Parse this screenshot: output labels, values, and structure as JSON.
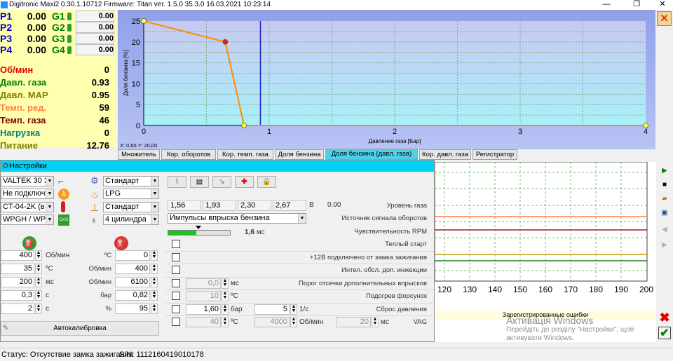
{
  "window": {
    "title": "Digitronic Maxi2 0.30.1.10712 Firmware: Titan  ver. 1.5.0  35.3.0  16.03.2021 10:23:14",
    "minimize": "—",
    "restore": "❐",
    "close": "✕"
  },
  "left": {
    "p": [
      {
        "label": "P1",
        "value": "0.00",
        "g_label": "G1",
        "g_value": "0.00"
      },
      {
        "label": "P2",
        "value": "0.00",
        "g_label": "G2",
        "g_value": "0.00"
      },
      {
        "label": "P3",
        "value": "0.00",
        "g_label": "G3",
        "g_value": "0.00"
      },
      {
        "label": "P4",
        "value": "0.00",
        "g_label": "G4",
        "g_value": "0.00"
      }
    ],
    "stats": [
      {
        "label": "Об/мин",
        "value": "0",
        "color": "#e00000"
      },
      {
        "label": "Давл. газа",
        "value": "0.93",
        "color": "#008000"
      },
      {
        "label": "Давл. MAP",
        "value": "0.95",
        "color": "#808000"
      },
      {
        "label": "Темп. ред.",
        "value": "59",
        "color": "#ff8040"
      },
      {
        "label": "Темп. газа",
        "value": "46",
        "color": "#800000"
      },
      {
        "label": "Нагрузка",
        "value": "0",
        "color": "#008080"
      },
      {
        "label": "Питание",
        "value": "12.76",
        "color": "#808000"
      }
    ]
  },
  "chart_data": {
    "type": "line",
    "xlabel": "Давление газа [Бар]",
    "ylabel": "Доля бензина [%]",
    "xlim": [
      0,
      4
    ],
    "ylim": [
      0,
      25
    ],
    "x_ticks": [
      "0",
      "1",
      "2",
      "3",
      "4"
    ],
    "y_ticks": [
      "0",
      "5",
      "10",
      "15",
      "20",
      "25"
    ],
    "series": [
      {
        "x": [
          0,
          0.65,
          0.8,
          4
        ],
        "y": [
          25,
          20,
          0,
          0
        ],
        "color": "#ff8c00"
      }
    ],
    "cursor_x": 0.93,
    "readout": "X: 0,65  Y: 20,00",
    "grid": true
  },
  "tabs": [
    {
      "label": "Множитель",
      "active": false
    },
    {
      "label": "Кор. оборотов",
      "active": false
    },
    {
      "label": "Кор. темп. газа",
      "active": false
    },
    {
      "label": "Доля бензина",
      "active": false
    },
    {
      "label": "Доля бензина (давл. газа)",
      "active": true
    },
    {
      "label": "Кор. давл. газа",
      "active": false
    },
    {
      "label": "Регистратор",
      "active": false
    }
  ],
  "background_chart": {
    "x_ticks": [
      "120",
      "130",
      "140",
      "150",
      "160",
      "170",
      "180",
      "190",
      "200"
    ],
    "errors_title": "Зарегистрированные ошибки"
  },
  "watermark": {
    "line1": "Активація Windows",
    "line2": "Перейдіть до розділу \"Настройки\", щоб",
    "line3": "активувати Windows."
  },
  "settings": {
    "title": "Настройки",
    "left_selects": [
      "VALTEK 30 3",
      "Не подключ",
      "CT-04-2K (в",
      "WPGH / WPL"
    ],
    "mid_selects": [
      "Стандарт",
      "LPG",
      "Стандарт",
      "4 цилиндра"
    ],
    "left_rows": [
      {
        "value": "400",
        "unit": "Об/мин"
      },
      {
        "value": "35",
        "unit": "ºC"
      },
      {
        "value": "200",
        "unit": "мс"
      },
      {
        "value": "0,3",
        "unit": "с"
      },
      {
        "value": "2",
        "unit": "с"
      }
    ],
    "mid_rows": [
      {
        "unit": "ºC",
        "value": "0"
      },
      {
        "unit": "Об/мин",
        "value": "400"
      },
      {
        "unit": "Об/мин",
        "value": "6100"
      },
      {
        "unit": "бар",
        "value": "0,82"
      },
      {
        "unit": "%",
        "value": "95"
      }
    ],
    "autocal": "Автокалибровка",
    "gas_levels": [
      "1,56",
      "1,93",
      "2,30",
      "2,67"
    ],
    "gas_unit": "В",
    "gas_value": "0.00",
    "gas_label": "Уровень газа",
    "rpm_source_select": "Импульсы впрыска бензина",
    "rpm_source_label": "Источник сигнала оборотов",
    "rpm_sens_value": "1,6",
    "rpm_sens_unit": "мс",
    "rpm_sens_label": "Чувствительность RPM",
    "rpm_sens_fraction": 0.45,
    "checks": [
      {
        "label": "Теплый старт"
      },
      {
        "label": "+12В подключено от замка зажигания"
      },
      {
        "label": "Интел. обсл. доп. инжекции"
      },
      {
        "label": "Порог отсечки дополнительных впрысков",
        "value": "0,0",
        "unit": "мс",
        "disabled": true
      },
      {
        "label": "Подогрев форсунок",
        "value": "10",
        "unit": "ºC",
        "disabled": true
      },
      {
        "label": "Сброс давления",
        "value": "1,60",
        "unit": "бар",
        "value2": "5",
        "unit2": "1/с"
      },
      {
        "label": "VAG",
        "value": "40",
        "unit": "ºC",
        "value2": "4000",
        "unit2": "Об/мин",
        "value3": "20",
        "unit3": "мс",
        "disabled": true
      }
    ]
  },
  "status": {
    "text": "Статус: Отсутствие замка зажигания",
    "serial": "S/N: 1112160419010178"
  }
}
